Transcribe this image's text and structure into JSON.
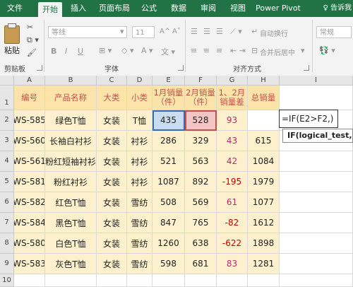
{
  "ribbon_tabs": [
    "文件",
    "开始",
    "插入",
    "页面布局",
    "公式",
    "数据",
    "审阅",
    "视图",
    "Power Pivot"
  ],
  "active_tab": "开始",
  "tell_me": "♀ 告诉我",
  "ribbon": {
    "paste_label": "粘贴",
    "clipboard_group": "剪贴板",
    "font_group": "字体",
    "align_group": "对齐方式",
    "font_name": "等线",
    "font_size": "11",
    "grow_font": "A^",
    "shrink_font": "A˅",
    "bold": "B",
    "italic": "I",
    "underline": "U",
    "wrap_text": "自动换行",
    "merge_center": "合并后居中",
    "number_format": "常规"
  },
  "sheet": {
    "columns": [
      "A",
      "B",
      "C",
      "D",
      "E",
      "F",
      "G",
      "H",
      "I"
    ],
    "row_numbers": [
      "1",
      "2",
      "3",
      "4",
      "5",
      "6",
      "7",
      "8",
      "9",
      "10"
    ],
    "headers": [
      "编号",
      "产品名称",
      "大类",
      "小类",
      "1月销量（件）",
      "2月销量（件）",
      "1、2月销量差",
      "总销量"
    ],
    "rows": [
      [
        "WS-585",
        "绿色T恤",
        "女装",
        "T恤",
        "435",
        "528",
        "93",
        ""
      ],
      [
        "WS-560",
        "长袖白衬衫",
        "女装",
        "衬衫",
        "286",
        "329",
        "43",
        "615"
      ],
      [
        "WS-561",
        "粉红短袖衬衫",
        "女装",
        "衬衫",
        "521",
        "563",
        "42",
        "1084"
      ],
      [
        "WS-581",
        "粉红衬衫",
        "女装",
        "衬衫",
        "1087",
        "892",
        "-195",
        "1979"
      ],
      [
        "WS-582",
        "红色T恤",
        "女装",
        "雪纺",
        "508",
        "569",
        "61",
        "1077"
      ],
      [
        "WS-584",
        "黑色T恤",
        "女装",
        "雪纺",
        "847",
        "765",
        "-82",
        "1612"
      ],
      [
        "WS-580",
        "白色T恤",
        "女装",
        "雪纺",
        "1260",
        "638",
        "-622",
        "1898"
      ],
      [
        "WS-583",
        "灰色T恤",
        "女装",
        "雪纺",
        "598",
        "681",
        "83",
        "1281"
      ]
    ],
    "edit_formula": "=IF(E2>F2,)",
    "formula_tooltip": "IF(logical_test,"
  }
}
